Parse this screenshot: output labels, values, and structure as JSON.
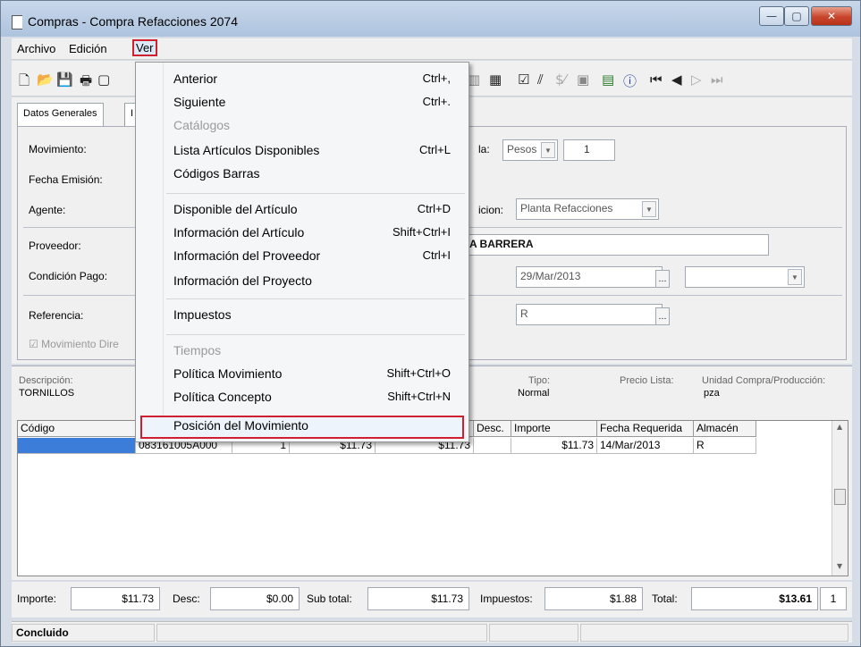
{
  "window": {
    "title": "Compras - Compra Refacciones 2074"
  },
  "menubar": {
    "archivo": "Archivo",
    "edicion": "Edición",
    "ver": "Ver"
  },
  "tabs": {
    "datos_generales": "Datos Generales",
    "second_initial": "I"
  },
  "form": {
    "movimiento_label": "Movimiento:",
    "fecha_emision_label": "Fecha Emisión:",
    "agente_label": "Agente:",
    "proveedor_label": "Proveedor:",
    "condicion_pago_label": "Condición Pago:",
    "referencia_label": "Referencia:",
    "movimiento_directo_label": "Movimiento Dire",
    "moneda_label": "la:",
    "moneda_value": "Pesos",
    "tipo_cambio_value": "1",
    "almacen_label": "icion:",
    "almacen_value": "Planta Refacciones",
    "proveedor_name": "A BARRERA",
    "fecha_value": "29/Mar/2013",
    "referencia_value": "R"
  },
  "detail": {
    "descripcion_label": "Descripción:",
    "descripcion_value": "TORNILLOS",
    "tipo_label": "Tipo:",
    "tipo_value": "Normal",
    "precio_lista_label": "Precio Lista:",
    "unidad_label": "Unidad Compra/Producción:",
    "unidad_value": "pza"
  },
  "grid": {
    "headers": {
      "codigo": "Código",
      "desc": "Desc.",
      "importe": "Importe",
      "fecha_requerida": "Fecha Requerida",
      "almacen": "Almacén"
    },
    "row1": {
      "articulo": "083161005A000",
      "cantidad": "1",
      "costo": "$11.73",
      "costo2": "$11.73",
      "importe": "$11.73",
      "fecha_requerida": "14/Mar/2013",
      "almacen": "R"
    }
  },
  "totals": {
    "importe_label": "Importe:",
    "importe_value": "$11.73",
    "desc_label": "Desc:",
    "desc_value": "$0.00",
    "subtotal_label": "Sub total:",
    "subtotal_value": "$11.73",
    "impuestos_label": "Impuestos:",
    "impuestos_value": "$1.88",
    "total_label": "Total:",
    "total_value": "$13.61",
    "count_value": "1"
  },
  "status": {
    "text": "Concluido"
  },
  "menu_ver": {
    "anterior": "Anterior",
    "anterior_sc": "Ctrl+,",
    "siguiente": "Siguiente",
    "siguiente_sc": "Ctrl+.",
    "catalogos": "Catálogos",
    "lista_articulos": "Lista Artículos Disponibles",
    "lista_articulos_sc": "Ctrl+L",
    "codigos_barras": "Códigos Barras",
    "disponible_articulo": "Disponible del Artículo",
    "disponible_articulo_sc": "Ctrl+D",
    "info_articulo": "Información del Artículo",
    "info_articulo_sc": "Shift+Ctrl+I",
    "info_proveedor": "Información del Proveedor",
    "info_proveedor_sc": "Ctrl+I",
    "info_proyecto": "Información del Proyecto",
    "impuestos": "Impuestos",
    "tiempos": "Tiempos",
    "politica_movimiento": "Política Movimiento",
    "politica_movimiento_sc": "Shift+Ctrl+O",
    "politica_concepto": "Política Concepto",
    "politica_concepto_sc": "Shift+Ctrl+N",
    "posicion_movimiento": "Posición del Movimiento"
  }
}
